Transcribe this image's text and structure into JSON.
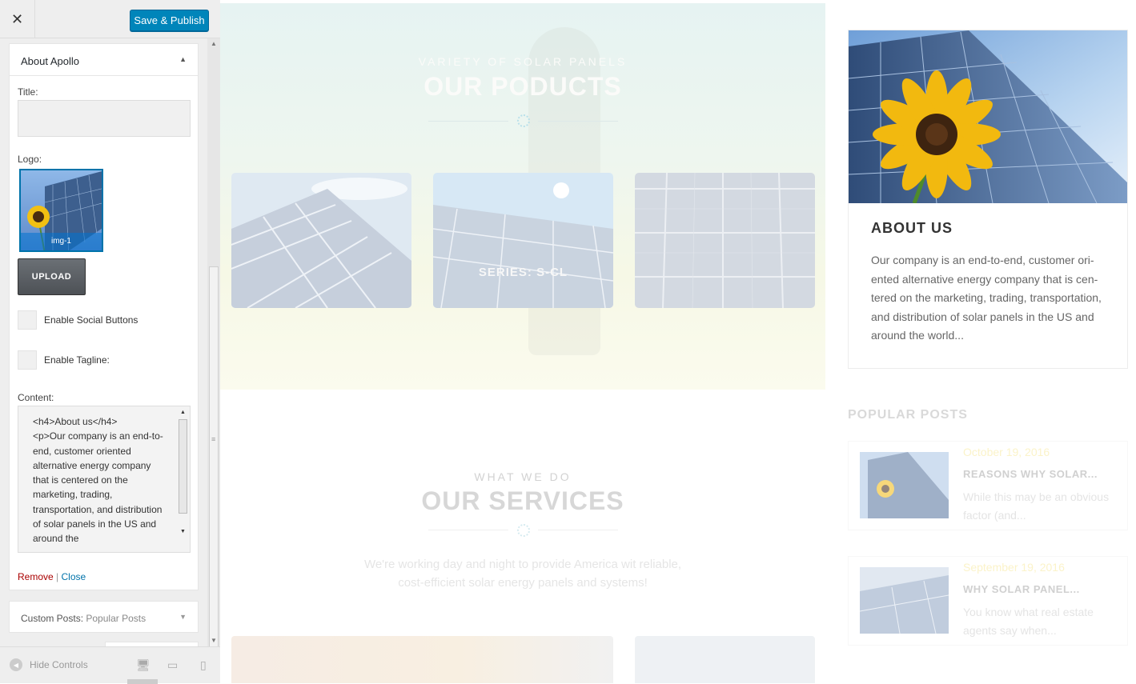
{
  "sidebar": {
    "close_icon": "close-icon",
    "publish_label": "Save & Publish",
    "widget": {
      "title": "About Apollo",
      "title_label": "Title:",
      "title_value": "",
      "logo_label": "Logo:",
      "logo_caption": "img-1",
      "upload_label": "UPLOAD",
      "social_label": "Enable Social Buttons",
      "tagline_label": "Enable Tagline:",
      "content_label": "Content:",
      "content_text": "<h4>About us</h4>\n<p>Our company is an end-to-end, customer oriented alternative energy company that is centered on the marketing, trading, transportation, and distribution of solar panels in the US and around the",
      "remove_label": "Remove",
      "separator": "|",
      "close_label": "Close"
    },
    "widget2": {
      "title": "Custom Posts:",
      "subtitle": "Popular Posts"
    },
    "footer": {
      "hide_controls_label": "Hide Controls",
      "devices": [
        "desktop-icon",
        "tablet-icon",
        "mobile-icon"
      ]
    }
  },
  "preview": {
    "products": {
      "subtitle": "VARIETY OF SOLAR PANELS",
      "title": "OUR PODUCTS",
      "card_label": "SERIES: S-CL"
    },
    "services": {
      "subtitle": "WHAT WE DO",
      "title": "OUR SERVICES",
      "text": "We're working day and night to provide America wit reliable, cost-efficient solar energy panels and systems!"
    },
    "about": {
      "title": "ABOUT US",
      "text": "Our company is an end-to-end, customer ori-ented alternative energy company that is cen-tered on the marketing, trading, transportation, and distribution of solar panels in the US and around the world..."
    },
    "popular": {
      "title": "POPULAR POSTS",
      "posts": [
        {
          "date": "October 19, 2016",
          "title": "REASONS WHY SOLAR...",
          "excerpt": "While this may be an obvious factor (and..."
        },
        {
          "date": "September 19, 2016",
          "title": "WHY SOLAR PANEL...",
          "excerpt": "You know what real estate agents say when..."
        }
      ]
    }
  },
  "colors": {
    "publish_blue": "#0085ba",
    "remove_red": "#aa0000",
    "link_blue": "#0073aa"
  }
}
